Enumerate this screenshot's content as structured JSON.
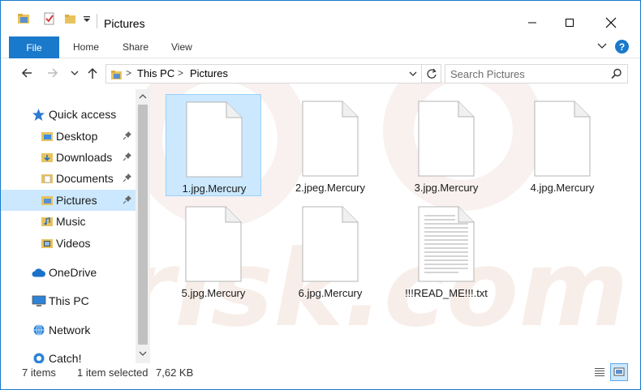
{
  "window": {
    "title": "Pictures",
    "accent": "#1979ca"
  },
  "ribbon": {
    "file_tab": "File",
    "tabs": [
      "Home",
      "Share",
      "View"
    ],
    "help_label": "?"
  },
  "address": {
    "crumbs": [
      "This PC",
      "Pictures"
    ],
    "search_placeholder": "Search Pictures"
  },
  "nav": {
    "quick_access": "Quick access",
    "items": [
      {
        "label": "Desktop",
        "icon": "desktop-folder-icon",
        "pinned": true
      },
      {
        "label": "Downloads",
        "icon": "downloads-folder-icon",
        "pinned": true
      },
      {
        "label": "Documents",
        "icon": "documents-folder-icon",
        "pinned": true
      },
      {
        "label": "Pictures",
        "icon": "pictures-folder-icon",
        "pinned": true,
        "selected": true
      },
      {
        "label": "Music",
        "icon": "music-folder-icon",
        "pinned": false
      },
      {
        "label": "Videos",
        "icon": "videos-folder-icon",
        "pinned": false
      }
    ],
    "onedrive": "OneDrive",
    "this_pc": "This PC",
    "network": "Network",
    "catch": "Catch!"
  },
  "files": [
    {
      "name": "1.jpg.Mercury",
      "type": "blank",
      "selected": true
    },
    {
      "name": "2.jpeg.Mercury",
      "type": "blank"
    },
    {
      "name": "3.jpg.Mercury",
      "type": "blank"
    },
    {
      "name": "4.jpg.Mercury",
      "type": "blank"
    },
    {
      "name": "5.jpg.Mercury",
      "type": "blank"
    },
    {
      "name": "6.jpg.Mercury",
      "type": "blank"
    },
    {
      "name": "!!!READ_ME!!!.txt",
      "type": "text"
    }
  ],
  "status": {
    "item_count": "7 items",
    "selection": "1 item selected",
    "size": "7,62 KB"
  }
}
